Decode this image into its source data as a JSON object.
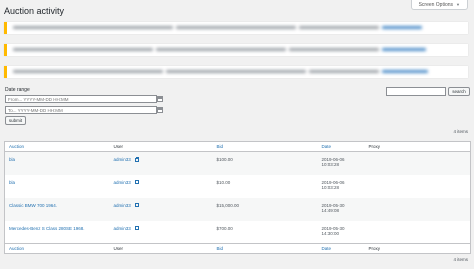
{
  "screen_options": {
    "label": "Screen Options",
    "caret": "▼"
  },
  "page": {
    "title": "Auction activity"
  },
  "filters": {
    "date_range_label": "Date range",
    "from_placeholder": "From... YYYY-MM-DD HH:MM",
    "to_placeholder": "To... YYYY-MM-DD HH:MM",
    "submit_label": "submit",
    "search_label": "search",
    "calendar_icon": "calendar-icon"
  },
  "items_count": "4 items",
  "table": {
    "columns": [
      "Auction",
      "User",
      "Bid",
      "Date",
      "Proxy"
    ],
    "rows": [
      {
        "auction": "bla",
        "user": "admin33",
        "bid": "$100.00",
        "date": "2019-06-06",
        "time": "10:03:28",
        "proxy": ""
      },
      {
        "auction": "bla",
        "user": "admin33",
        "bid": "$10.00",
        "date": "2019-06-06",
        "time": "10:03:28",
        "proxy": ""
      },
      {
        "auction": "Classic BMW 700 1964.",
        "user": "admin33",
        "bid": "$15,000.00",
        "date": "2019-05-30",
        "time": "14:49:08",
        "proxy": ""
      },
      {
        "auction": "Mercedes-Benz S Class 280SE 1968.",
        "user": "admin33",
        "bid": "$700.00",
        "date": "2019-05-30",
        "time": "14:30:00",
        "proxy": ""
      }
    ]
  },
  "colors": {
    "link": "#2271b1",
    "notice_border": "#ffb900"
  }
}
